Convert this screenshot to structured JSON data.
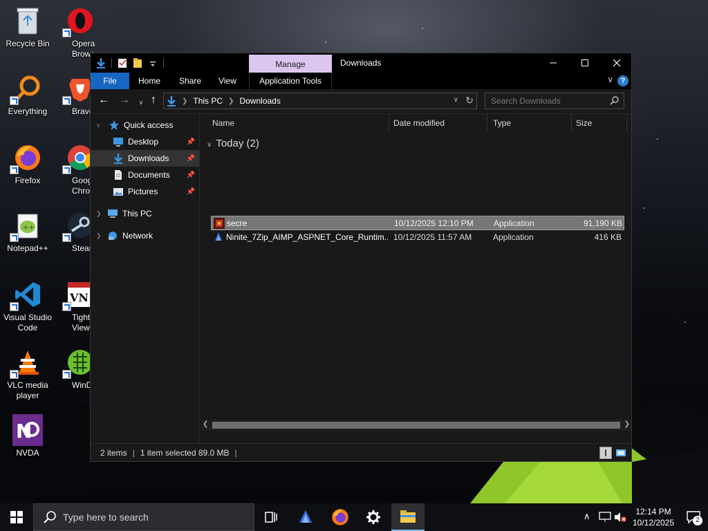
{
  "desktop": {
    "icons": [
      {
        "label": "Recycle Bin",
        "icon": "recycle-bin-icon"
      },
      {
        "label": "Opera Brows",
        "icon": "opera-icon"
      },
      {
        "label": "Everything",
        "icon": "everything-icon"
      },
      {
        "label": "Brave",
        "icon": "brave-icon"
      },
      {
        "label": "Firefox",
        "icon": "firefox-icon"
      },
      {
        "label": "Googl Chrom",
        "icon": "chrome-icon"
      },
      {
        "label": "Notepad++",
        "icon": "notepad-plus-plus-icon"
      },
      {
        "label": "Steam",
        "icon": "steam-icon"
      },
      {
        "label": "Visual Studio Code",
        "icon": "vscode-icon"
      },
      {
        "label": "TightVN Viewe",
        "icon": "tightvnc-icon"
      },
      {
        "label": "VLC media player",
        "icon": "vlc-icon"
      },
      {
        "label": "WinDirS",
        "icon": "windirstat-icon"
      },
      {
        "label": "NVDA",
        "icon": "nvda-icon"
      }
    ]
  },
  "explorer": {
    "title": "Downloads",
    "manage_tab": "Manage",
    "ribbon_tabs": [
      "File",
      "Home",
      "Share",
      "View",
      "Application Tools"
    ],
    "address": {
      "root": "This PC",
      "current": "Downloads"
    },
    "search_placeholder": "Search Downloads",
    "nav": {
      "quick_access": "Quick access",
      "items": [
        {
          "label": "Desktop",
          "pinned": true
        },
        {
          "label": "Downloads",
          "pinned": true
        },
        {
          "label": "Documents",
          "pinned": true
        },
        {
          "label": "Pictures",
          "pinned": true
        }
      ],
      "this_pc": "This PC",
      "network": "Network"
    },
    "columns": [
      "Name",
      "Date modified",
      "Type",
      "Size"
    ],
    "group": "Today (2)",
    "files": [
      {
        "name": "secre",
        "date": "10/12/2025 12:10 PM",
        "type": "Application",
        "size": "91,190 KB",
        "selected": true
      },
      {
        "name": "Ninite_7Zip_AIMP_ASPNET_Core_Runtim...",
        "date": "10/12/2025 11:57 AM",
        "type": "Application",
        "size": "416 KB",
        "selected": false
      }
    ],
    "status": {
      "items": "2 items",
      "selected": "1 item selected  89.0 MB",
      "sep": "|"
    }
  },
  "taskbar": {
    "search_placeholder": "Type here to search",
    "apps": [
      "task-view-icon",
      "ninite-icon",
      "firefox-icon",
      "settings-icon",
      "file-explorer-icon"
    ],
    "clock_time": "12:14 PM",
    "clock_date": "10/12/2025",
    "notifications": "2"
  },
  "colors": {
    "accent": "#1766c2",
    "manage": "#dcc6ef",
    "selected_row": "#777777"
  }
}
